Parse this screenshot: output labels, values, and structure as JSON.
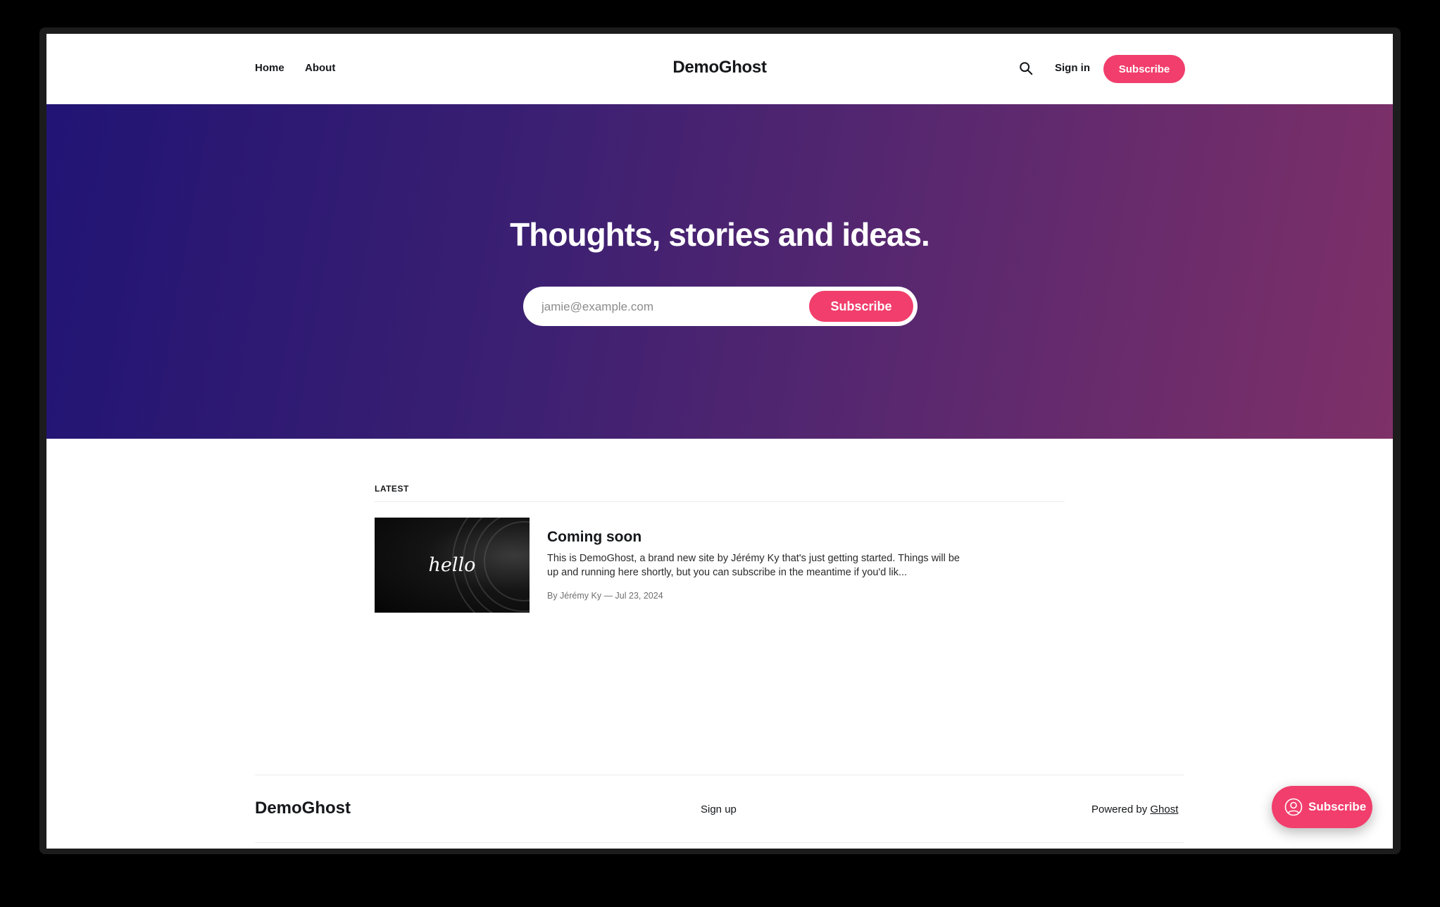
{
  "header": {
    "nav": [
      "Home",
      "About"
    ],
    "site_title": "DemoGhost",
    "search_icon": "search-icon",
    "signin_label": "Sign in",
    "subscribe_label": "Subscribe"
  },
  "hero": {
    "title": "Thoughts, stories and ideas.",
    "email_placeholder": "jamie@example.com",
    "subscribe_label": "Subscribe"
  },
  "feed": {
    "section_label": "LATEST",
    "posts": [
      {
        "image_text": "hello",
        "title": "Coming soon",
        "excerpt": "This is DemoGhost, a brand new site by Jérémy Ky that's just getting started. Things will be up and running here shortly, but you can subscribe in the meantime if you'd lik...",
        "meta": "By Jérémy Ky — Jul 23, 2024"
      }
    ]
  },
  "footer": {
    "site_title": "DemoGhost",
    "signup_label": "Sign up",
    "powered_prefix": "Powered by",
    "powered_link": "Ghost"
  },
  "portal": {
    "icon": "user-circle-icon",
    "label": "Subscribe"
  },
  "colors": {
    "accent": "#f13e6c",
    "hero_gradient_start": "#211474",
    "hero_gradient_end": "#7e3068",
    "text": "#15171a"
  }
}
